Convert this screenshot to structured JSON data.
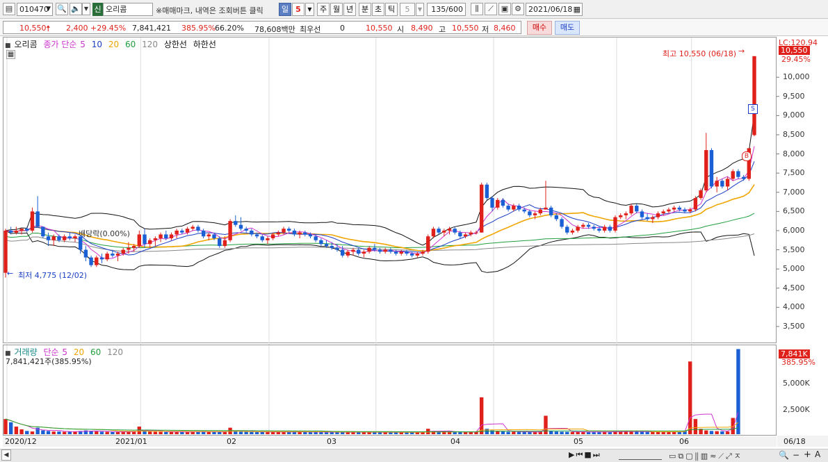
{
  "toolbar": {
    "code": "010470",
    "badge": "신",
    "name": "오리콤",
    "notice": "※매매마크, 내역은 조회버튼 클릭",
    "period_selected": "일",
    "period_num": "5",
    "periods": [
      "주",
      "월",
      "년",
      "분",
      "초",
      "틱"
    ],
    "tick_num": "5",
    "count": "135/600",
    "date": "2021/06/18"
  },
  "quote": {
    "price": "10,550",
    "change": "2,400",
    "change_pct": "+29.45%",
    "volume": "7,841,421",
    "volume_ratio": "385.95%",
    "turnover": "66.20%",
    "amount": "78,608백만",
    "pref_label": "최우선",
    "pref_value": "0",
    "pref_price": "10,550",
    "open_label": "시",
    "open": "8,490",
    "high_label": "고",
    "high": "10,550",
    "low_label": "저",
    "low": "8,460",
    "buy_label": "매수",
    "sell_label": "매도"
  },
  "price_legend": {
    "stock": "오리콤",
    "ma_title": "종가 단순",
    "ma": [
      "5",
      "10",
      "20",
      "60",
      "120"
    ],
    "upper": "상한선",
    "lower": "하한선"
  },
  "annotations": {
    "high": "최고 10,550 (06/18)",
    "low": "최저 4,775 (12/02)",
    "dividend": "배당락(0.00%)",
    "mark_s": "S",
    "mark_b": "B"
  },
  "price_axis": {
    "top_label": "LC:120.94",
    "current_tag": "10,550",
    "current_pct": "29.45%",
    "ticks": [
      "10,000",
      "9,500",
      "9,000",
      "8,500",
      "8,000",
      "7,500",
      "7,000",
      "6,500",
      "6,000",
      "5,500",
      "5,000",
      "4,500",
      "4,000",
      "3,500"
    ]
  },
  "volume_legend": {
    "title": "거래량",
    "ma_title": "단순",
    "ma": [
      "5",
      "20",
      "60",
      "120"
    ],
    "value_line": "7,841,421주(385.95%)"
  },
  "volume_axis": {
    "current_tag": "7,841K",
    "current_pct": "385.95%",
    "ticks": [
      "5,000K",
      "2,500K"
    ]
  },
  "dates": [
    "2020/12",
    "2021/01",
    "02",
    "03",
    "04",
    "05",
    "06"
  ],
  "date_right": "06/18",
  "colors": {
    "up": "#e0211b",
    "down": "#1a5fd4",
    "ma5": "#cc33cc",
    "ma10": "#1a3ec6",
    "ma20": "#f0a500",
    "ma60": "#1e9e3c",
    "ma120": "#888888"
  },
  "chart_data": {
    "type": "candlestick",
    "x_range": [
      "2020/12/01",
      "2021/06/18"
    ],
    "ylim": [
      3100,
      11000
    ],
    "volume_ylim": [
      0,
      8000000
    ],
    "candles": [
      [
        4900,
        6050,
        4775,
        6000
      ],
      [
        6000,
        6100,
        5900,
        5950
      ],
      [
        5950,
        6100,
        5900,
        6000
      ],
      [
        6000,
        6050,
        5900,
        6050
      ],
      [
        6050,
        6100,
        5950,
        6000
      ],
      [
        6000,
        6600,
        5950,
        6500
      ],
      [
        6500,
        6900,
        6100,
        6100
      ],
      [
        6100,
        6100,
        5800,
        5850
      ],
      [
        5850,
        5950,
        5600,
        5750
      ],
      [
        5750,
        5900,
        5600,
        5850
      ],
      [
        5850,
        5900,
        5700,
        5750
      ],
      [
        5750,
        5900,
        5700,
        5850
      ],
      [
        5850,
        5950,
        5750,
        5800
      ],
      [
        5800,
        5900,
        5700,
        5850
      ],
      [
        5850,
        5850,
        5400,
        5500
      ],
      [
        5500,
        5600,
        5200,
        5300
      ],
      [
        5300,
        5350,
        5050,
        5100
      ],
      [
        5100,
        5350,
        5050,
        5300
      ],
      [
        5300,
        5400,
        5150,
        5250
      ],
      [
        5250,
        5450,
        5200,
        5400
      ],
      [
        5400,
        5500,
        5300,
        5350
      ],
      [
        5350,
        5450,
        5200,
        5400
      ],
      [
        5400,
        5550,
        5350,
        5500
      ],
      [
        5500,
        5700,
        5400,
        5550
      ],
      [
        5550,
        5650,
        5450,
        5600
      ],
      [
        5600,
        6000,
        5550,
        5900
      ],
      [
        5900,
        6050,
        5550,
        5650
      ],
      [
        5650,
        5800,
        5550,
        5750
      ],
      [
        5750,
        5850,
        5600,
        5800
      ],
      [
        5800,
        5950,
        5700,
        5900
      ],
      [
        5900,
        6000,
        5750,
        5800
      ],
      [
        5800,
        5950,
        5750,
        5900
      ],
      [
        5900,
        6050,
        5800,
        6000
      ],
      [
        6000,
        6050,
        5900,
        5950
      ],
      [
        5950,
        6100,
        5900,
        6050
      ],
      [
        6050,
        6150,
        6000,
        6100
      ],
      [
        6100,
        6150,
        5950,
        6000
      ],
      [
        6000,
        6050,
        5800,
        5850
      ],
      [
        5850,
        5950,
        5750,
        5900
      ],
      [
        5900,
        5950,
        5750,
        5800
      ],
      [
        5800,
        5850,
        5550,
        5600
      ],
      [
        5600,
        5850,
        5550,
        5750
      ],
      [
        5750,
        6300,
        5700,
        6250
      ],
      [
        6250,
        6400,
        6100,
        6150
      ],
      [
        6150,
        6350,
        6000,
        6050
      ],
      [
        6050,
        6100,
        5950,
        6000
      ],
      [
        6000,
        6050,
        5850,
        5900
      ],
      [
        5900,
        5950,
        5800,
        5850
      ],
      [
        5850,
        5900,
        5700,
        5750
      ],
      [
        5750,
        5850,
        5650,
        5800
      ],
      [
        5800,
        5950,
        5750,
        5900
      ],
      [
        5900,
        6000,
        5850,
        5950
      ],
      [
        5950,
        6100,
        5900,
        6050
      ],
      [
        6050,
        6100,
        5950,
        6000
      ],
      [
        6000,
        6050,
        5850,
        5900
      ],
      [
        5900,
        6000,
        5800,
        5950
      ],
      [
        5950,
        6000,
        5850,
        5900
      ],
      [
        5900,
        5950,
        5800,
        5850
      ],
      [
        5850,
        5900,
        5700,
        5750
      ],
      [
        5750,
        5800,
        5600,
        5650
      ],
      [
        5650,
        5750,
        5550,
        5600
      ],
      [
        5600,
        5700,
        5500,
        5550
      ],
      [
        5550,
        5650,
        5450,
        5500
      ],
      [
        5500,
        5600,
        5300,
        5350
      ],
      [
        5350,
        5500,
        5300,
        5450
      ],
      [
        5450,
        5550,
        5350,
        5500
      ],
      [
        5500,
        5550,
        5350,
        5400
      ],
      [
        5400,
        5500,
        5300,
        5450
      ],
      [
        5450,
        5600,
        5400,
        5550
      ],
      [
        5550,
        5650,
        5450,
        5500
      ],
      [
        5500,
        5550,
        5400,
        5450
      ],
      [
        5450,
        5550,
        5400,
        5500
      ],
      [
        5500,
        5550,
        5400,
        5450
      ],
      [
        5450,
        5500,
        5350,
        5400
      ],
      [
        5400,
        5500,
        5350,
        5450
      ],
      [
        5450,
        5500,
        5350,
        5400
      ],
      [
        5400,
        5450,
        5300,
        5350
      ],
      [
        5350,
        5450,
        5300,
        5400
      ],
      [
        5400,
        5500,
        5350,
        5450
      ],
      [
        5450,
        5900,
        5400,
        5850
      ],
      [
        5850,
        6100,
        5800,
        6050
      ],
      [
        6050,
        6100,
        5900,
        5950
      ],
      [
        5950,
        6050,
        5850,
        6000
      ],
      [
        6000,
        6100,
        5900,
        6050
      ],
      [
        6050,
        6100,
        5900,
        5950
      ],
      [
        5950,
        6000,
        5800,
        5850
      ],
      [
        5850,
        5950,
        5800,
        5900
      ],
      [
        5900,
        6000,
        5850,
        5950
      ],
      [
        5950,
        6000,
        5900,
        5950
      ],
      [
        5950,
        7250,
        5950,
        7200
      ],
      [
        7200,
        7250,
        6800,
        6850
      ],
      [
        6850,
        6900,
        6500,
        6600
      ],
      [
        6600,
        6850,
        6550,
        6800
      ],
      [
        6800,
        6850,
        6600,
        6650
      ],
      [
        6650,
        6700,
        6500,
        6550
      ],
      [
        6550,
        6700,
        6500,
        6650
      ],
      [
        6650,
        6700,
        6500,
        6550
      ],
      [
        6550,
        6600,
        6450,
        6500
      ],
      [
        6500,
        6550,
        6350,
        6400
      ],
      [
        6400,
        6500,
        6300,
        6450
      ],
      [
        6450,
        6600,
        6400,
        6550
      ],
      [
        6550,
        7300,
        6550,
        6600
      ],
      [
        6600,
        6650,
        6350,
        6400
      ],
      [
        6400,
        6450,
        6250,
        6300
      ],
      [
        6300,
        6350,
        6050,
        6100
      ],
      [
        6100,
        6150,
        5900,
        5950
      ],
      [
        5950,
        6050,
        5900,
        6000
      ],
      [
        6000,
        6150,
        5950,
        6100
      ],
      [
        6100,
        6200,
        6050,
        6150
      ],
      [
        6150,
        6200,
        6050,
        6100
      ],
      [
        6100,
        6150,
        6000,
        6050
      ],
      [
        6050,
        6100,
        5950,
        6000
      ],
      [
        6000,
        6150,
        5950,
        6100
      ],
      [
        6100,
        6150,
        5950,
        6000
      ],
      [
        6000,
        6400,
        5950,
        6350
      ],
      [
        6350,
        6450,
        6300,
        6400
      ],
      [
        6400,
        6500,
        6300,
        6450
      ],
      [
        6450,
        6700,
        6400,
        6650
      ],
      [
        6650,
        6700,
        6450,
        6500
      ],
      [
        6500,
        6550,
        6300,
        6350
      ],
      [
        6350,
        6450,
        6250,
        6300
      ],
      [
        6300,
        6400,
        6200,
        6350
      ],
      [
        6350,
        6500,
        6300,
        6450
      ],
      [
        6450,
        6550,
        6400,
        6500
      ],
      [
        6500,
        6600,
        6450,
        6550
      ],
      [
        6550,
        6650,
        6500,
        6600
      ],
      [
        6600,
        6650,
        6500,
        6550
      ],
      [
        6550,
        6600,
        6450,
        6500
      ],
      [
        6500,
        6600,
        6450,
        6550
      ],
      [
        6550,
        6900,
        6500,
        6850
      ],
      [
        6850,
        7100,
        6800,
        7050
      ],
      [
        7050,
        8550,
        7000,
        8100
      ],
      [
        8100,
        8150,
        7100,
        7150
      ],
      [
        7150,
        7400,
        7000,
        7300
      ],
      [
        7300,
        7350,
        7100,
        7150
      ],
      [
        7150,
        7400,
        7050,
        7350
      ],
      [
        7350,
        7600,
        7300,
        7550
      ],
      [
        7550,
        7600,
        7350,
        7400
      ],
      [
        7400,
        7450,
        7300,
        7350
      ],
      [
        7350,
        8150,
        7300,
        8150
      ],
      [
        8490,
        10550,
        8460,
        10550
      ]
    ],
    "volumes": [
      1400000,
      1100000,
      700000,
      450000,
      300000,
      250000,
      600000,
      350000,
      300000,
      250000,
      250000,
      220000,
      230000,
      240000,
      300000,
      350000,
      320000,
      250000,
      230000,
      220000,
      200000,
      210000,
      230000,
      260000,
      240000,
      700000,
      300000,
      250000,
      230000,
      220000,
      210000,
      200000,
      230000,
      220000,
      210000,
      230000,
      250000,
      230000,
      210000,
      200000,
      220000,
      210000,
      600000,
      250000,
      230000,
      220000,
      210000,
      200000,
      220000,
      210000,
      200000,
      210000,
      230000,
      220000,
      210000,
      220000,
      200000,
      190000,
      210000,
      200000,
      190000,
      180000,
      200000,
      190000,
      180000,
      190000,
      200000,
      190000,
      180000,
      190000,
      180000,
      170000,
      180000,
      190000,
      180000,
      170000,
      180000,
      170000,
      180000,
      500000,
      300000,
      250000,
      220000,
      230000,
      210000,
      200000,
      210000,
      220000,
      210000,
      3400000,
      500000,
      350000,
      300000,
      250000,
      220000,
      230000,
      210000,
      200000,
      220000,
      210000,
      230000,
      1700000,
      300000,
      250000,
      230000,
      220000,
      210000,
      200000,
      220000,
      210000,
      200000,
      210000,
      230000,
      220000,
      260000,
      240000,
      280000,
      250000,
      230000,
      220000,
      210000,
      220000,
      230000,
      220000,
      210000,
      200000,
      250000,
      300000,
      6700000,
      1400000,
      500000,
      350000,
      300000,
      280000,
      260000,
      250000,
      1500000,
      7841421
    ]
  }
}
